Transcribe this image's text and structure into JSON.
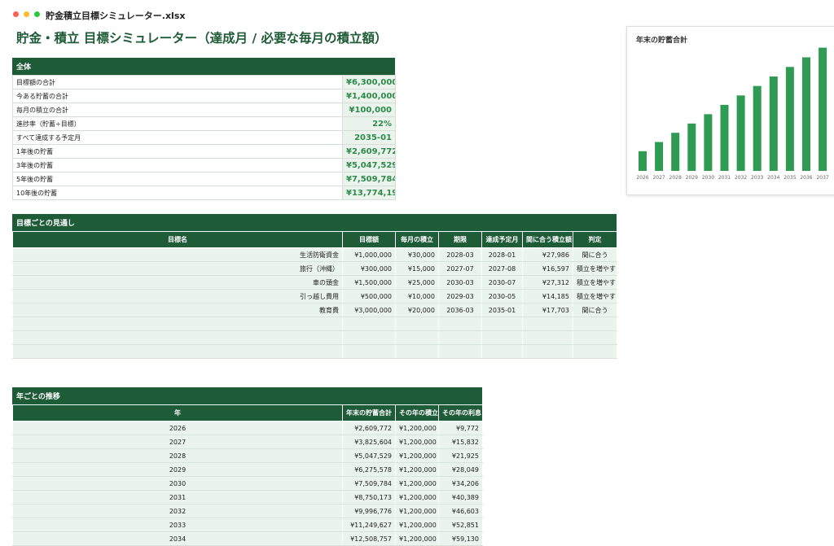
{
  "window": {
    "file_title": "貯金積立目標シミュレーター.xlsx"
  },
  "page_title": "貯金・積立 目標シミュレーター（達成月 / 必要な毎月の積立額）",
  "summary": {
    "header": "全体",
    "rows": [
      {
        "label": "目標額の合計",
        "value": "¥6,300,000"
      },
      {
        "label": "今ある貯蓄の合計",
        "value": "¥1,400,000"
      },
      {
        "label": "毎月の積立の合計",
        "value": "¥100,000"
      },
      {
        "label": "進捗率（貯蓄÷目標）",
        "value": "22%"
      },
      {
        "label": "すべて達成する予定月",
        "value": "2035-01"
      },
      {
        "label": "1年後の貯蓄",
        "value": "¥2,609,772"
      },
      {
        "label": "3年後の貯蓄",
        "value": "¥5,047,529"
      },
      {
        "label": "5年後の貯蓄",
        "value": "¥7,509,784"
      },
      {
        "label": "10年後の貯蓄",
        "value": "¥13,774,198"
      }
    ]
  },
  "goals": {
    "header": "目標ごとの見通し",
    "columns": [
      "目標名",
      "目標額",
      "毎月の積立",
      "期限",
      "達成予定月",
      "間に合う積立額",
      "判定"
    ],
    "rows": [
      [
        "生活防衛資金",
        "¥1,000,000",
        "¥30,000",
        "2028-03",
        "2028-01",
        "¥27,986",
        "間に合う"
      ],
      [
        "旅行（沖縄）",
        "¥300,000",
        "¥15,000",
        "2027-07",
        "2027-08",
        "¥16,597",
        "積立を増やす"
      ],
      [
        "車の頭金",
        "¥1,500,000",
        "¥25,000",
        "2030-03",
        "2030-07",
        "¥27,312",
        "積立を増やす"
      ],
      [
        "引っ越し費用",
        "¥500,000",
        "¥10,000",
        "2029-03",
        "2030-05",
        "¥14,185",
        "積立を増やす"
      ],
      [
        "教育費",
        "¥3,000,000",
        "¥20,000",
        "2036-03",
        "2035-01",
        "¥17,703",
        "間に合う"
      ],
      [
        "",
        "",
        "",
        "",
        "",
        "",
        ""
      ],
      [
        "",
        "",
        "",
        "",
        "",
        "",
        ""
      ],
      [
        "",
        "",
        "",
        "",
        "",
        "",
        ""
      ]
    ]
  },
  "years": {
    "header": "年ごとの推移",
    "columns": [
      "年",
      "年末の貯蓄合計",
      "その年の積立",
      "その年の利息"
    ],
    "rows": [
      [
        "2026",
        "¥2,609,772",
        "¥1,200,000",
        "¥9,772"
      ],
      [
        "2027",
        "¥3,825,604",
        "¥1,200,000",
        "¥15,832"
      ],
      [
        "2028",
        "¥5,047,529",
        "¥1,200,000",
        "¥21,925"
      ],
      [
        "2029",
        "¥6,275,578",
        "¥1,200,000",
        "¥28,049"
      ],
      [
        "2030",
        "¥7,509,784",
        "¥1,200,000",
        "¥34,206"
      ],
      [
        "2031",
        "¥8,750,173",
        "¥1,200,000",
        "¥40,389"
      ],
      [
        "2032",
        "¥9,996,776",
        "¥1,200,000",
        "¥46,603"
      ],
      [
        "2033",
        "¥11,249,627",
        "¥1,200,000",
        "¥52,851"
      ],
      [
        "2034",
        "¥12,508,757",
        "¥1,200,000",
        "¥59,130"
      ]
    ]
  },
  "chart_data": {
    "type": "bar",
    "title": "年末の貯蓄合計",
    "categories": [
      "2026",
      "2027",
      "2028",
      "2029",
      "2030",
      "2031",
      "2032",
      "2033",
      "2034",
      "2035",
      "2036",
      "2037"
    ],
    "values": [
      2609772,
      3825604,
      5047529,
      6275578,
      7509784,
      8750173,
      9996776,
      11249627,
      12508757,
      13774198,
      15050000,
      16330000
    ],
    "color": "#2e9a52",
    "ylim": [
      0,
      16500000
    ],
    "grid": false,
    "legend": "none"
  },
  "colors": {
    "accent": "#1e5b37",
    "value_text": "#2f8a4a",
    "cell_fill": "#eaf4ec"
  }
}
